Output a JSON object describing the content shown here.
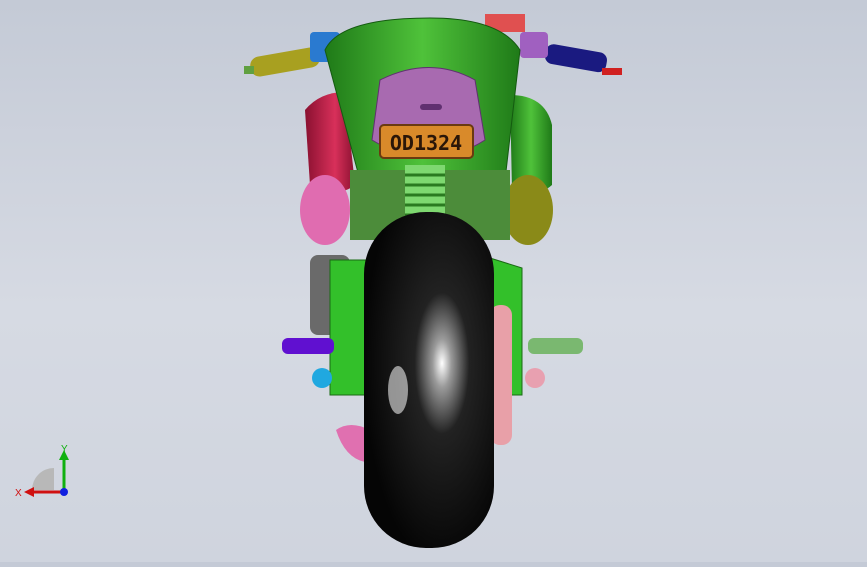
{
  "model": {
    "license_plate": "OD1324"
  },
  "triad": {
    "x_label": "X",
    "y_label": "Y",
    "x_color": "#d01010",
    "y_color": "#10b010",
    "z_color": "#1020e0"
  },
  "colors": {
    "fairing": "#3aa42a",
    "tire": "#0b0b0b",
    "plate": "#d98a2a",
    "tail_panel": "#a86ab0",
    "red_panel": "#c2204a",
    "pink_part": "#e070b0",
    "swingarm": "#33c02a",
    "purple_peg": "#6010d0",
    "blue_grip": "#1a1a80",
    "yellow_grip": "#a0a020"
  }
}
